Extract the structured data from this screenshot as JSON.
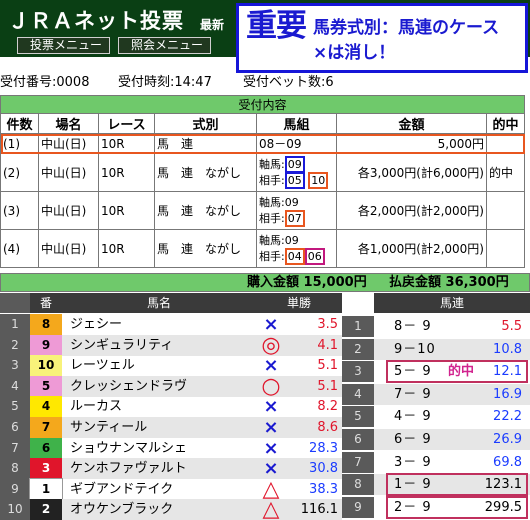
{
  "header": {
    "logo": "ＪＲＡネット投票",
    "latest": "最新",
    "menu_bet": "投票メニュー",
    "menu_inquiry": "照会メニュー"
  },
  "annotation": {
    "big": "重要",
    "line1": "馬券式別：馬連のケース",
    "line2": "×は消し！"
  },
  "info": {
    "receipt_no": "受付番号:0008",
    "receipt_time": "受付時刻:14:47",
    "bet_count": "受付ベット数:6"
  },
  "receipt": {
    "title": "受付内容",
    "headers": [
      "件数",
      "場名",
      "レース",
      "式別",
      "馬組",
      "金額",
      "的中"
    ],
    "rows": [
      {
        "no": "(1)",
        "venue": "中山(日)",
        "race": "10R",
        "type": "馬　連",
        "combo": "08－09",
        "amount": "5,000円",
        "hit": ""
      },
      {
        "no": "(2)",
        "venue": "中山(日)",
        "race": "10R",
        "type": "馬　連　ながし",
        "axis_label": "軸馬:",
        "axis": "09",
        "partner_label": "相手:",
        "partner_a": "05",
        "partner_b": "10",
        "amount": "各3,000円(計6,000円)",
        "hit": "的中"
      },
      {
        "no": "(3)",
        "venue": "中山(日)",
        "race": "10R",
        "type": "馬　連　ながし",
        "axis_label": "軸馬:",
        "axis": "09",
        "partner_label": "相手:",
        "partner_a": "07",
        "amount": "各2,000円(計2,000円)",
        "hit": ""
      },
      {
        "no": "(4)",
        "venue": "中山(日)",
        "race": "10R",
        "type": "馬　連　ながし",
        "axis_label": "軸馬:",
        "axis": "09",
        "partner_label": "相手:",
        "partner_a": "04",
        "partner_b": "06",
        "amount": "各1,000円(計2,000円)",
        "hit": ""
      }
    ],
    "purchase_total": "購入金額 15,000円",
    "payout_total": "払戻金額 36,300円"
  },
  "horses": {
    "headers": {
      "num": "番",
      "name": "馬名",
      "win": "単勝"
    },
    "rows": [
      {
        "num": "1",
        "gate": "8",
        "gate_bg": "#f4a81c",
        "gate_fg": "#000000",
        "name": "ジェシー",
        "mark": "×",
        "odds": "3.5",
        "odds_color": "#e0152b"
      },
      {
        "num": "2",
        "gate": "9",
        "gate_bg": "#ee9ad6",
        "gate_fg": "#000000",
        "name": "シンギュラリティ",
        "mark": "◎",
        "odds": "4.1",
        "odds_color": "#e0152b"
      },
      {
        "num": "3",
        "gate": "10",
        "gate_bg": "#f8f27a",
        "gate_fg": "#000000",
        "name": "レーツェル",
        "mark": "×",
        "odds": "5.1",
        "odds_color": "#e0152b"
      },
      {
        "num": "4",
        "gate": "5",
        "gate_bg": "#ee9ad6",
        "gate_fg": "#000000",
        "name": "クレッシェンドラヴ",
        "mark": "○",
        "odds": "5.1",
        "odds_color": "#e0152b"
      },
      {
        "num": "5",
        "gate": "4",
        "gate_bg": "#ffe800",
        "gate_fg": "#000000",
        "name": "ルーカス",
        "mark": "×",
        "odds": "8.2",
        "odds_color": "#e0152b"
      },
      {
        "num": "6",
        "gate": "7",
        "gate_bg": "#f4a81c",
        "gate_fg": "#000000",
        "name": "サンティール",
        "mark": "×",
        "odds": "8.6",
        "odds_color": "#e0152b"
      },
      {
        "num": "7",
        "gate": "6",
        "gate_bg": "#3fb24a",
        "gate_fg": "#000000",
        "name": "ショウナンマルシェ",
        "mark": "×",
        "odds": "28.3",
        "odds_color": "#1b3cff"
      },
      {
        "num": "8",
        "gate": "3",
        "gate_bg": "#e0152b",
        "gate_fg": "#ffffff",
        "name": "ケンホファヴァルト",
        "mark": "×",
        "odds": "30.8",
        "odds_color": "#1b3cff"
      },
      {
        "num": "9",
        "gate": "1",
        "gate_bg": "#ffffff",
        "gate_fg": "#000000",
        "name": "ギブアンドテイク",
        "mark": "△",
        "odds": "38.3",
        "odds_color": "#1b3cff"
      },
      {
        "num": "10",
        "gate": "2",
        "gate_bg": "#222222",
        "gate_fg": "#ffffff",
        "name": "オウケンブラック",
        "mark": "△",
        "odds": "116.1",
        "odds_color": "#000000"
      }
    ]
  },
  "quinella": {
    "header": "馬連",
    "rows": [
      {
        "rank": "1",
        "combo": "8－ 9",
        "odds": "5.5",
        "color": "#e0152b"
      },
      {
        "rank": "2",
        "combo": "9－10",
        "odds": "10.8",
        "color": "#1b3cff"
      },
      {
        "rank": "3",
        "combo": "5－ 9",
        "odds": "12.1",
        "color": "#1b3cff",
        "hit_label": "的中"
      },
      {
        "rank": "4",
        "combo": "7－ 9",
        "odds": "16.9",
        "color": "#1b3cff"
      },
      {
        "rank": "5",
        "combo": "4－ 9",
        "odds": "22.2",
        "color": "#1b3cff"
      },
      {
        "rank": "6",
        "combo": "6－ 9",
        "odds": "26.9",
        "color": "#1b3cff"
      },
      {
        "rank": "7",
        "combo": "3－ 9",
        "odds": "69.8",
        "color": "#1b3cff"
      },
      {
        "rank": "8",
        "combo": "1－ 9",
        "odds": "123.1",
        "color": "#000000"
      },
      {
        "rank": "9",
        "combo": "2－ 9",
        "odds": "299.5",
        "color": "#000000"
      }
    ]
  }
}
